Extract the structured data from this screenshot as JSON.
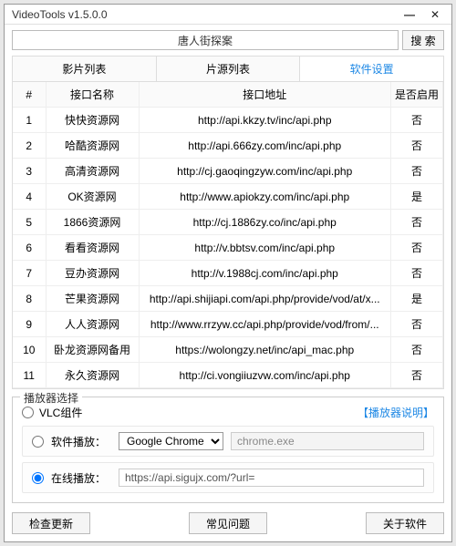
{
  "window": {
    "title": "VideoTools v1.5.0.0"
  },
  "search": {
    "value": "唐人街探案",
    "button": "搜 索"
  },
  "tabs": {
    "list": "影片列表",
    "source": "片源列表",
    "settings": "软件设置"
  },
  "table": {
    "headers": {
      "idx": "#",
      "name": "接口名称",
      "addr": "接口地址",
      "enabled": "是否启用"
    },
    "rows": [
      {
        "idx": "1",
        "name": "快快资源网",
        "addr": "http://api.kkzy.tv/inc/api.php",
        "enabled": "否"
      },
      {
        "idx": "2",
        "name": "哈酷资源网",
        "addr": "http://api.666zy.com/inc/api.php",
        "enabled": "否"
      },
      {
        "idx": "3",
        "name": "高清资源网",
        "addr": "http://cj.gaoqingzyw.com/inc/api.php",
        "enabled": "否"
      },
      {
        "idx": "4",
        "name": "OK资源网",
        "addr": "http://www.apiokzy.com/inc/api.php",
        "enabled": "是"
      },
      {
        "idx": "5",
        "name": "1866资源网",
        "addr": "http://cj.1886zy.co/inc/api.php",
        "enabled": "否"
      },
      {
        "idx": "6",
        "name": "看看资源网",
        "addr": "http://v.bbtsv.com/inc/api.php",
        "enabled": "否"
      },
      {
        "idx": "7",
        "name": "豆办资源网",
        "addr": "http://v.1988cj.com/inc/api.php",
        "enabled": "否"
      },
      {
        "idx": "8",
        "name": "芒果资源网",
        "addr": "http://api.shijiapi.com/api.php/provide/vod/at/x...",
        "enabled": "是"
      },
      {
        "idx": "9",
        "name": "人人资源网",
        "addr": "http://www.rrzyw.cc/api.php/provide/vod/from/...",
        "enabled": "否"
      },
      {
        "idx": "10",
        "name": "卧龙资源网备用",
        "addr": "https://wolongzy.net/inc/api_mac.php",
        "enabled": "否"
      },
      {
        "idx": "11",
        "name": "永久资源网",
        "addr": "http://ci.vongiiuzvw.com/inc/api.php",
        "enabled": "否"
      }
    ]
  },
  "player": {
    "legend": "播放器选择",
    "vlc_label": "VLC组件",
    "help_link": "【播放器说明】",
    "soft_label": "软件播放：",
    "soft_select": "Google Chrome",
    "soft_exe": "chrome.exe",
    "online_label": "在线播放：",
    "online_url": "https://api.sigujx.com/?url="
  },
  "footer": {
    "update": "检查更新",
    "faq": "常见问题",
    "about": "关于软件"
  }
}
